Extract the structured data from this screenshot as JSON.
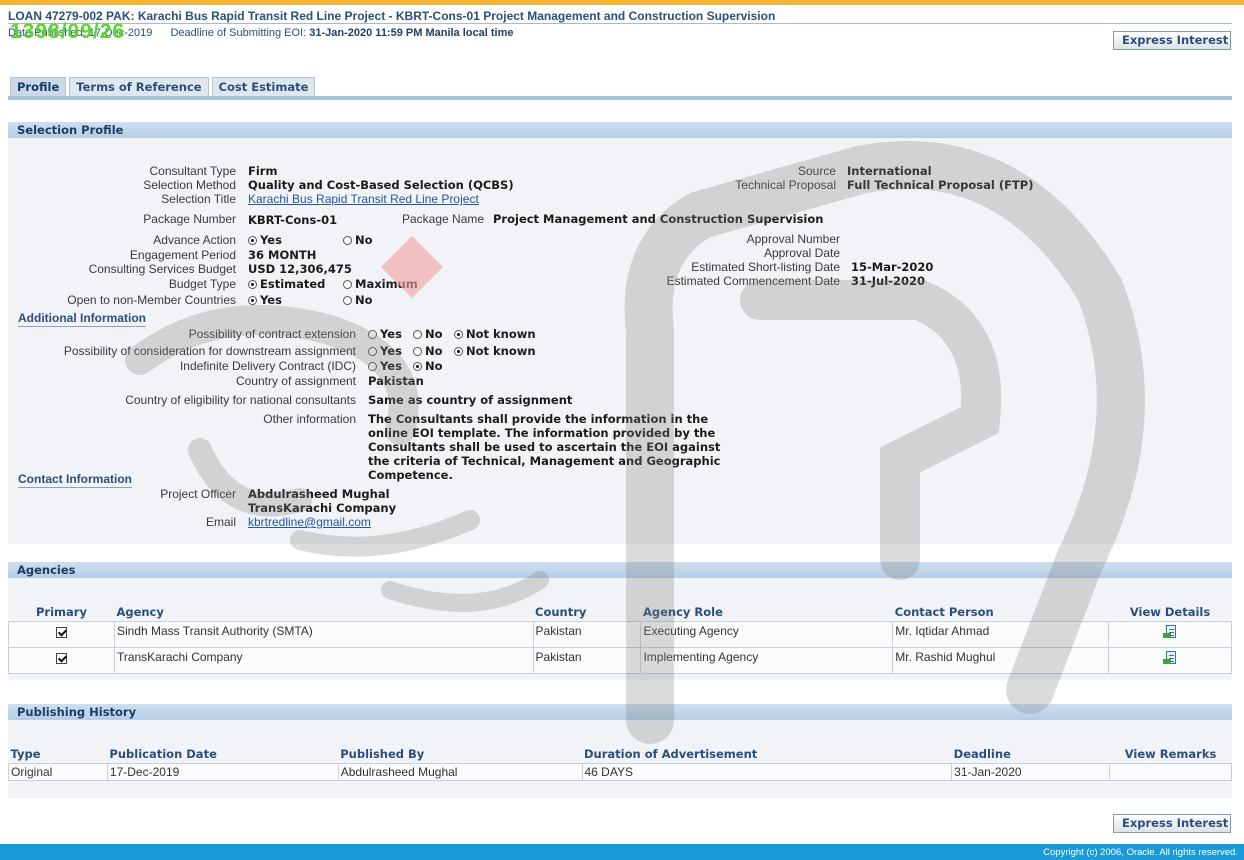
{
  "header": {
    "title": "LOAN 47279-002 PAK: Karachi Bus Rapid Transit Red Line Project - KBRT-Cons-01 Project Management and Construction Supervision",
    "date_published_label": "Date Published:",
    "date_published": "17-Dec-2019",
    "deadline_label": "Deadline of Submitting EOI:",
    "deadline": "31-Jan-2020 11:59 PM Manila local time",
    "stamp": "1398/09/26",
    "express_interest": "Express Interest"
  },
  "tabs": [
    {
      "label": "Profile",
      "active": true
    },
    {
      "label": "Terms of Reference",
      "active": false
    },
    {
      "label": "Cost Estimate",
      "active": false
    }
  ],
  "selection_profile": {
    "heading": "Selection Profile",
    "consultant_type_label": "Consultant Type",
    "consultant_type": "Firm",
    "selection_method_label": "Selection Method",
    "selection_method": "Quality and Cost-Based Selection (QCBS)",
    "selection_title_label": "Selection Title",
    "selection_title": "Karachi Bus Rapid Transit Red Line Project",
    "source_label": "Source",
    "source": "International",
    "technical_proposal_label": "Technical Proposal",
    "technical_proposal": "Full Technical Proposal (FTP)",
    "package_number_label": "Package Number",
    "package_number": "KBRT-Cons-01",
    "package_name_label": "Package Name",
    "package_name": "Project Management and Construction Supervision",
    "advance_action_label": "Advance Action",
    "engagement_period_label": "Engagement Period",
    "engagement_period": "36 MONTH",
    "budget_label": "Consulting Services Budget",
    "budget": "USD 12,306,475",
    "budget_type_label": "Budget Type",
    "open_label": "Open to non-Member Countries",
    "approval_number_label": "Approval Number",
    "approval_date_label": "Approval Date",
    "shortlisting_label": "Estimated Short-listing Date",
    "shortlisting_date": "15-Mar-2020",
    "commencement_label": "Estimated Commencement Date",
    "commencement_date": "31-Jul-2020",
    "opt_yes": "Yes",
    "opt_no": "No",
    "opt_estimated": "Estimated",
    "opt_maximum": "Maximum",
    "opt_not_known": "Not known"
  },
  "additional": {
    "heading": "Additional Information",
    "extension_label": "Possibility of contract extension",
    "downstream_label": "Possibility of consideration for downstream assignment",
    "idc_label": "Indefinite Delivery Contract (IDC)",
    "country_label": "Country of assignment",
    "country": "Pakistan",
    "eligibility_label": "Country of eligibility for national consultants",
    "eligibility": "Same as country of assignment",
    "other_label": "Other information",
    "other": "The Consultants shall provide the information in the online EOI template. The information provided by the Consultants shall be used to ascertain the EOI against the criteria of Technical, Management and Geographic Competence."
  },
  "contact": {
    "heading": "Contact Information",
    "officer_label": "Project Officer",
    "officer": "Abdulrasheed Mughal",
    "company": "TransKarachi Company",
    "email_label": "Email",
    "email": "kbrtredline@gmail.com"
  },
  "agencies": {
    "heading": "Agencies",
    "columns": [
      "Primary",
      "Agency",
      "Country",
      "Agency Role",
      "Contact Person",
      "View Details"
    ],
    "rows": [
      {
        "agency": "Sindh Mass Transit Authority (SMTA)",
        "country": "Pakistan",
        "role": "Executing Agency",
        "contact": "Mr. Iqtidar Ahmad"
      },
      {
        "agency": "TransKarachi Company",
        "country": "Pakistan",
        "role": "Implementing Agency",
        "contact": "Mr. Rashid Mughul"
      }
    ]
  },
  "history": {
    "heading": "Publishing History",
    "columns": [
      "Type",
      "Publication Date",
      "Published By",
      "Duration of Advertisement",
      "Deadline",
      "View Remarks"
    ],
    "rows": [
      {
        "type": "Original",
        "date": "17-Dec-2019",
        "by": "Abdulrasheed Mughal",
        "duration": "46 DAYS",
        "deadline": "31-Jan-2020",
        "remarks": ""
      }
    ]
  },
  "footer": {
    "copyright": "Copyright (c) 2006, Oracle. All rights reserved."
  },
  "colors": {
    "accent_bar": "#f7b333",
    "section_header": "#b5cde6",
    "footer_bar": "#1a9ad6",
    "link": "#2356a3",
    "stamp": "#5ad62c"
  }
}
